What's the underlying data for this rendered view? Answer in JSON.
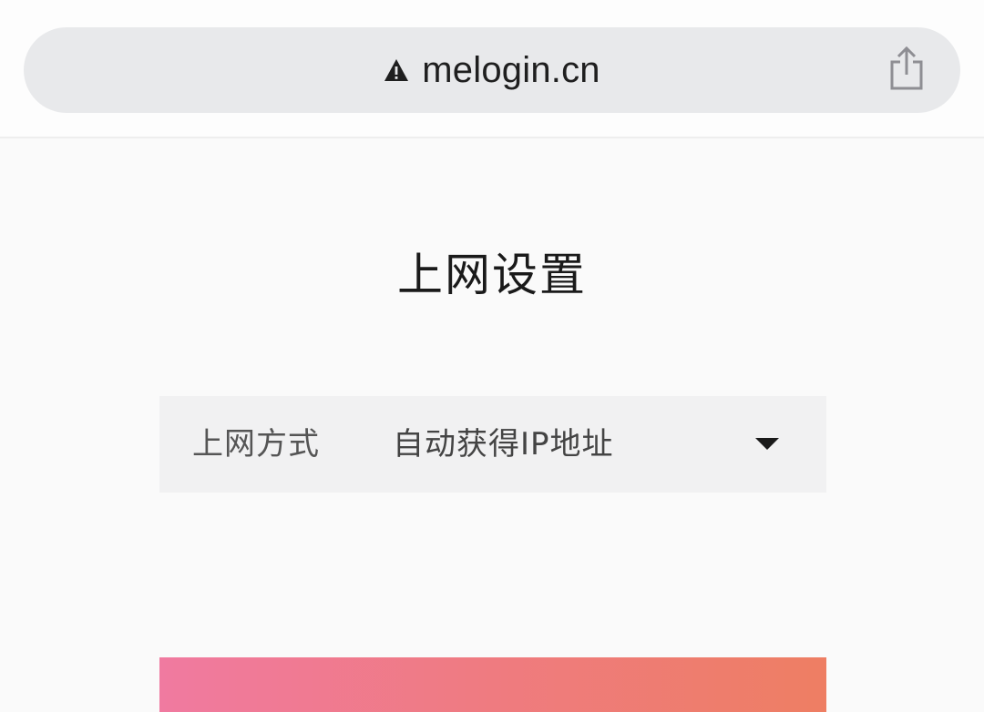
{
  "browser": {
    "url": "melogin.cn",
    "security_icon": "warning-triangle-icon",
    "share_icon": "share-icon"
  },
  "page": {
    "title": "上网设置"
  },
  "connection": {
    "label": "上网方式",
    "selected_value": "自动获得IP地址",
    "dropdown_icon": "caret-down-icon"
  },
  "colors": {
    "address_bar": "#e8e9eb",
    "row_background": "#f1f1f2",
    "button_gradient_start": "#f07aa0",
    "button_gradient_end": "#ee7e63"
  }
}
